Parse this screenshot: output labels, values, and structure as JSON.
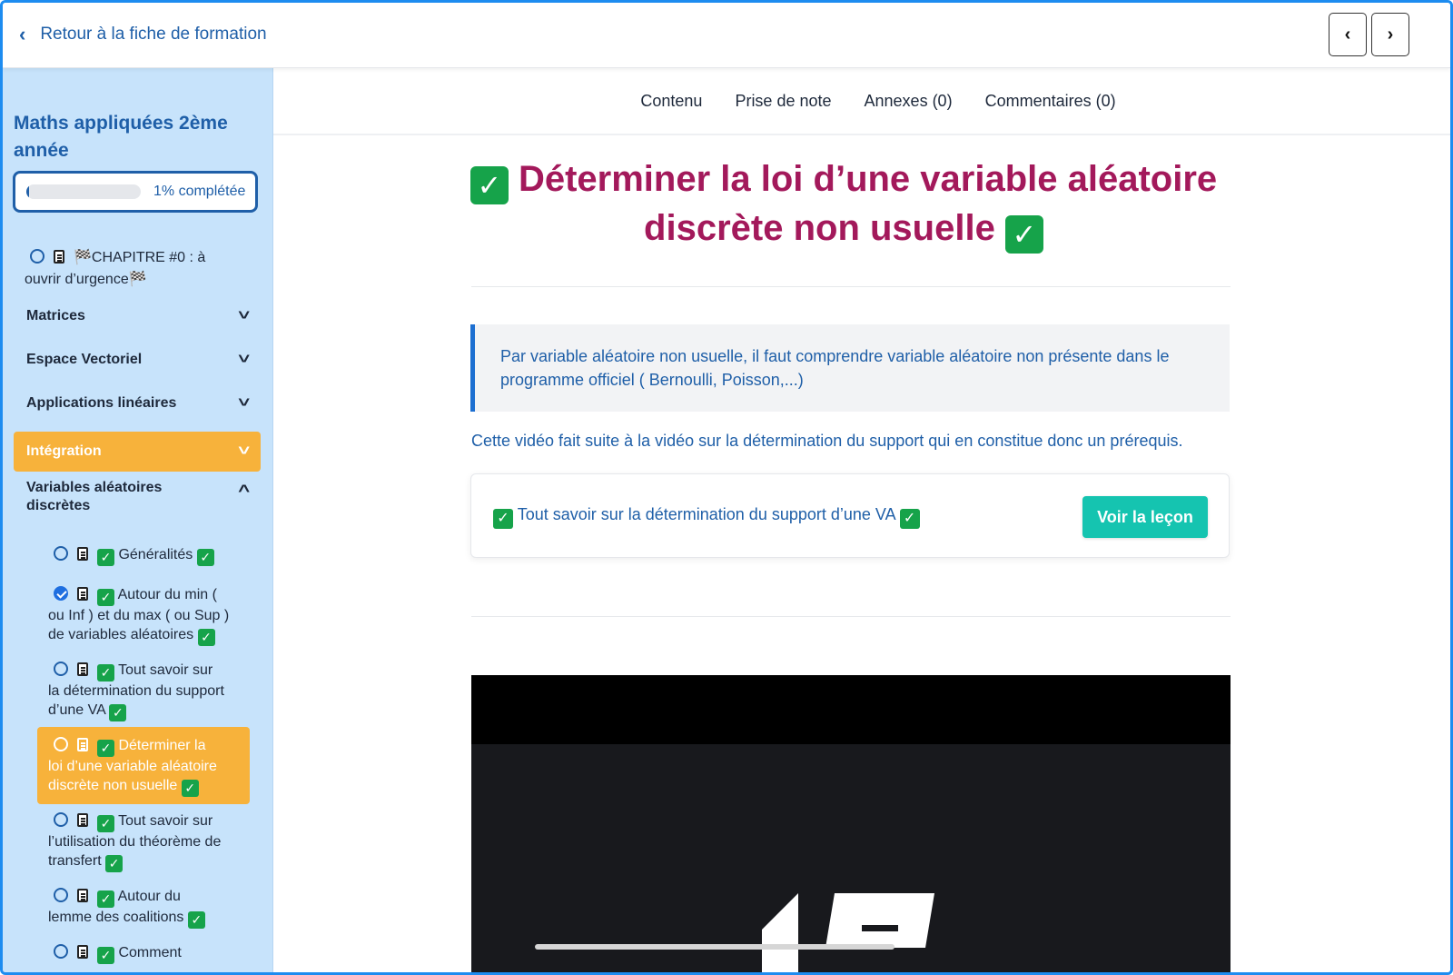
{
  "topbar": {
    "back_label": "Retour à la fiche de formation",
    "prev_icon": "chevron-left-icon",
    "next_icon": "chevron-right-icon"
  },
  "sidebar": {
    "course_title": "Maths appliquées 2ème année",
    "progress_percent": 1,
    "progress_label": "1% complétée",
    "chapter0": {
      "text": "🏁CHAPITRE #0 : à ouvrir d’urgence🏁",
      "line1": "🏁CHAPITRE #0 : à",
      "line2": "ouvrir d’urgence🏁",
      "completed": false
    },
    "sections": [
      {
        "label": "Matrices",
        "expanded": false
      },
      {
        "label": "Espace Vectoriel",
        "expanded": false
      },
      {
        "label": "Applications linéaires",
        "expanded": false
      },
      {
        "label": "Intégration",
        "expanded": false,
        "active": true
      },
      {
        "label": "Variables aléatoires discrètes",
        "line1": "Variables aléatoires",
        "line2": "discrètes",
        "expanded": true
      }
    ],
    "lessons": [
      {
        "line1": "Généralités",
        "completed": false
      },
      {
        "line1": "Autour du min (",
        "line2": "ou Inf ) et du max ( ou Sup )",
        "line3": "de variables aléatoires",
        "completed": true
      },
      {
        "line1": "Tout savoir sur",
        "line2": "la détermination du support",
        "line3": "d’une VA",
        "completed": false
      },
      {
        "line1": "Déterminer la",
        "line2": "loi d’une variable aléatoire",
        "line3": "discrète non usuelle",
        "completed": false,
        "active": true
      },
      {
        "line1": "Tout savoir sur",
        "line2": "l’utilisation du théorème de",
        "line3": "transfert",
        "completed": false
      },
      {
        "line1": "Autour du",
        "line2": "lemme des coalitions",
        "completed": false
      },
      {
        "line1": "Comment",
        "completed": false
      }
    ]
  },
  "main": {
    "tabs": [
      "Contenu",
      "Prise de note",
      "Annexes (0)",
      "Commentaires (0)"
    ],
    "title_line1": "Déterminer la loi d’une variable aléatoire",
    "title_line2": "discrète non usuelle",
    "callout_text": "Par variable aléatoire non usuelle, il faut comprendre variable aléatoire non présente dans le programme officiel ( Bernoulli, Poisson,...)",
    "intro_text": "Cette vidéo fait suite à la vidéo sur la détermination du support qui en constitue donc un prérequis.",
    "link_card": {
      "text": "Tout savoir sur la détermination du support d’une VA",
      "button_label": "Voir la leçon"
    },
    "check_glyph": "✓"
  }
}
